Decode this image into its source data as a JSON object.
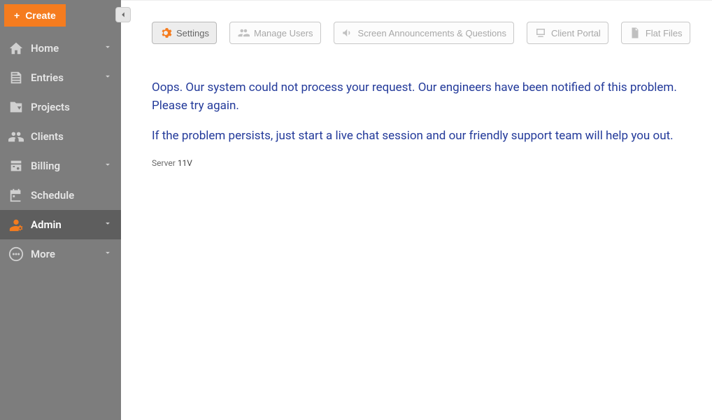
{
  "sidebar": {
    "create_label": "Create",
    "items": [
      {
        "label": "Home",
        "has_chev": true
      },
      {
        "label": "Entries",
        "has_chev": true
      },
      {
        "label": "Projects",
        "has_chev": false
      },
      {
        "label": "Clients",
        "has_chev": false
      },
      {
        "label": "Billing",
        "has_chev": true
      },
      {
        "label": "Schedule",
        "has_chev": false
      },
      {
        "label": "Admin",
        "has_chev": true
      },
      {
        "label": "More",
        "has_chev": true
      }
    ]
  },
  "tabs": {
    "settings": "Settings",
    "manage_users": "Manage Users",
    "announcements": "Screen Announcements & Questions",
    "client_portal": "Client Portal",
    "flat_files": "Flat Files"
  },
  "error": {
    "line1": "Oops. Our system could not process your request. Our engineers have been notified of this problem. Please try again.",
    "line2": "If the problem persists, just start a live chat session and our friendly support team will help you out."
  },
  "server_label": "Server",
  "server_value": "11V"
}
